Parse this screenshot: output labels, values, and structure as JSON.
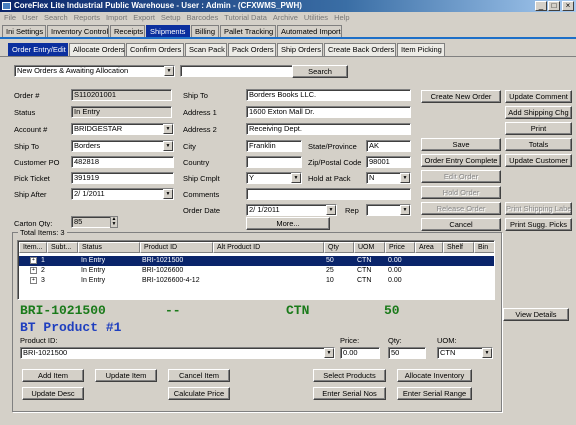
{
  "window": {
    "title": "CoreFlex Lite Industrial Public Warehouse - User : Admin - (CFXWMS_PWH)"
  },
  "menu": [
    "File",
    "User",
    "Search",
    "Reports",
    "Import",
    "Export",
    "Setup",
    "Barcodes",
    "Tutorial Data",
    "Archive",
    "Utilities",
    "Help"
  ],
  "main_tabs": [
    "Ini Settings",
    "Inventory Control",
    "Receipts",
    "Shipments",
    "Billing",
    "Pallet Tracking",
    "Automated Import"
  ],
  "sub_tabs": [
    "Order Entry/Edit",
    "Allocate Orders",
    "Confirm Orders",
    "Scan Pack",
    "Pack Orders",
    "Ship Orders",
    "Create Back Orders",
    "Item Picking"
  ],
  "filter": {
    "value": "New Orders & Awaiting Allocation",
    "search_value": "",
    "search_label": "Search"
  },
  "form": {
    "order_label": "Order #",
    "order": "S110201001",
    "status_label": "Status",
    "status": "In Entry",
    "account_label": "Account #",
    "account": "BRIDGESTAR",
    "shipto_label": "Ship To",
    "shipto_combo": "Borders",
    "po_label": "Customer PO",
    "po": "482818",
    "pick_label": "Pick Ticket",
    "pick": "391919",
    "shipafter_label": "Ship After",
    "shipafter": "2/  1/2011",
    "carton_label": "Carton Qty:",
    "carton": "85",
    "shipto2_label": "Ship To",
    "shipto_name": "Borders Books LLC.",
    "addr1_label": "Address 1",
    "addr1": "1600 Exton Mall Dr.",
    "addr2_label": "Address 2",
    "addr2": "Receiving Dept.",
    "city_label": "City",
    "city": "Franklin",
    "state_label": "State/Province",
    "state": "AK",
    "country_label": "Country",
    "country": "",
    "zip_label": "Zip/Postal Code",
    "zip": "98001",
    "shipcmplt_label": "Ship Cmplt",
    "shipcmplt": "Y",
    "hold_label": "Hold at Pack",
    "hold": "N",
    "comments_label": "Comments",
    "comments": "",
    "orderdate_label": "Order Date",
    "orderdate": "2/  1/2011",
    "rep_label": "Rep",
    "rep": "",
    "more_label": "More..."
  },
  "right_buttons": {
    "create_new_order": "Create New Order",
    "update_comment": "Update Comment",
    "add_shipping_chg": "Add Shipping Chg",
    "print": "Print",
    "save": "Save",
    "totals": "Totals",
    "order_entry_complete": "Order Entry Complete",
    "update_customer": "Update Customer",
    "edit_order": "Edit Order",
    "hold_order": "Hold Order",
    "release_order": "Release Order",
    "print_shipping_label": "Print Shipping Label",
    "cancel": "Cancel",
    "print_sugg_picks": "Print Sugg. Picks",
    "view_details": "View Details"
  },
  "items": {
    "total_label": "Total Items: 3",
    "columns": [
      "Item...",
      "Subt...",
      "Status",
      "Product ID",
      "Alt Product ID",
      "Qty",
      "UOM",
      "Price",
      "Area",
      "Shelf",
      "Bin"
    ],
    "rows": [
      {
        "item": "1",
        "status": "In Entry",
        "product": "BRI-1021500",
        "alt": "",
        "qty": "50",
        "uom": "CTN",
        "price": "0.00"
      },
      {
        "item": "2",
        "status": "In Entry",
        "product": "BRI-1026600",
        "alt": "",
        "qty": "25",
        "uom": "CTN",
        "price": "0.00"
      },
      {
        "item": "3",
        "status": "In Entry",
        "product": "BRI-1026600-4-12",
        "alt": "",
        "qty": "10",
        "uom": "CTN",
        "price": "0.00"
      }
    ]
  },
  "detail": {
    "big_product": "BRI-1021500",
    "big_dash": "--",
    "big_uom": "CTN",
    "big_qty": "50",
    "description": "BT Product #1",
    "product_label": "Product ID:",
    "product": "BRI-1021500",
    "price_label": "Price:",
    "price": "0.00",
    "qty_label": "Qty:",
    "qty": "50",
    "uom_label": "UOM:",
    "uom": "CTN"
  },
  "bottom_buttons": {
    "add_item": "Add Item",
    "update_item": "Update Item",
    "cancel_item": "Cancel Item",
    "select_products": "Select Products",
    "allocate_inventory": "Allocate Inventory",
    "update_desc": "Update Desc",
    "calculate_price": "Calculate Price",
    "enter_serial_nos": "Enter Serial Nos",
    "enter_serial_range": "Enter Serial Range"
  },
  "colors": {
    "active_tab": "#0b2f9e",
    "selected_row": "#0a246a",
    "big_product_text": "#1a7a1a",
    "description_text": "#1f3fbf",
    "tab_rule": "#1c6fc8"
  }
}
